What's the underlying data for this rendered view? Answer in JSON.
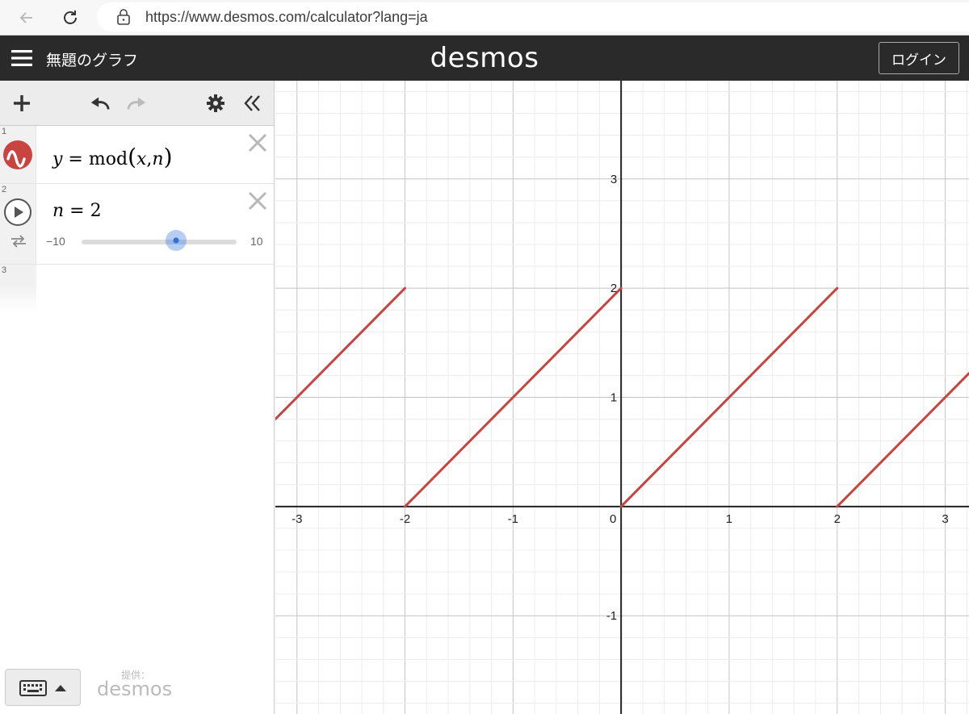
{
  "browser": {
    "url": "https://www.desmos.com/calculator?lang=ja"
  },
  "header": {
    "title": "無題のグラフ",
    "brand": "desmos",
    "login_label": "ログイン"
  },
  "expressions": [
    {
      "index": "1",
      "lhs": "y",
      "eq": " = ",
      "func": "mod",
      "args_open": "(",
      "arg1": "x",
      "comma": ",",
      "arg2": "n",
      "args_close": ")"
    },
    {
      "index": "2",
      "var": "n",
      "eq": " = ",
      "value": "2",
      "slider_min": "−10",
      "slider_max": "10",
      "slider_value": 2
    },
    {
      "index": "3"
    }
  ],
  "footer": {
    "powered_by": "提供：",
    "brand": "desmos"
  },
  "colors": {
    "curve": "#c74440",
    "accent_blue": "#2f72dc",
    "header_bg": "#2a2a2a"
  },
  "chart_data": {
    "type": "line",
    "function": "y = mod(x, n)",
    "parameter_n": 2,
    "xlim": [
      -3.2,
      3.22
    ],
    "ylim": [
      -1.9,
      3.9
    ],
    "x_ticks": [
      -3,
      -2,
      -1,
      0,
      1,
      2,
      3
    ],
    "x_tick_labels": [
      "-3",
      "-2",
      "-1",
      "0",
      "1",
      "2",
      "3"
    ],
    "y_ticks": [
      -1,
      1,
      2,
      3
    ],
    "y_tick_labels": [
      "-1",
      "1",
      "2",
      "3"
    ],
    "grid": true,
    "minor_step": 0.2,
    "series": [
      {
        "segments": [
          [
            [
              -3.2,
              0.8
            ],
            [
              -2.0,
              2.0
            ]
          ],
          [
            [
              -2.0,
              0.0
            ],
            [
              0.0,
              2.0
            ]
          ],
          [
            [
              0.0,
              0.0
            ],
            [
              2.0,
              2.0
            ]
          ],
          [
            [
              2.0,
              0.0
            ],
            [
              3.22,
              1.22
            ]
          ]
        ]
      }
    ]
  }
}
